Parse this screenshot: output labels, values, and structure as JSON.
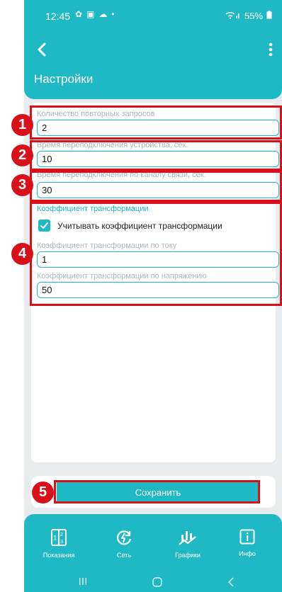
{
  "status_bar": {
    "time": "12:45",
    "battery": "55%"
  },
  "header": {
    "title": "Настройки"
  },
  "settings": {
    "retry_count": {
      "label": "Количество повторных запросов",
      "value": "2"
    },
    "device_reconnect": {
      "label": "Время переподключения устройства, сек.",
      "value": "10"
    },
    "channel_reconnect": {
      "label": "Время переподключения по каналу связи, сек.",
      "value": "30"
    },
    "transformation": {
      "section_title": "Коэффициент трансформации",
      "use_checkbox_label": "Учитывать коэффициент трансформации",
      "use_checked": true,
      "current": {
        "label": "Коэффициент трансформации по току",
        "value": "1"
      },
      "voltage": {
        "label": "Коэффициент трансформации по напряжению",
        "value": "50"
      }
    }
  },
  "save_label": "Сохранить",
  "bottom_nav": [
    {
      "label": "Показания",
      "icon": "readings-icon"
    },
    {
      "label": "Сеть",
      "icon": "network-icon"
    },
    {
      "label": "Графики",
      "icon": "charts-icon"
    },
    {
      "label": "Инфо",
      "icon": "info-icon"
    }
  ],
  "annotations": [
    "1",
    "2",
    "3",
    "4",
    "5"
  ],
  "colors": {
    "primary": "#1fb9c6",
    "background": "#e9ecee",
    "annotation": "#d8101a",
    "label": "#a9b7bf"
  }
}
